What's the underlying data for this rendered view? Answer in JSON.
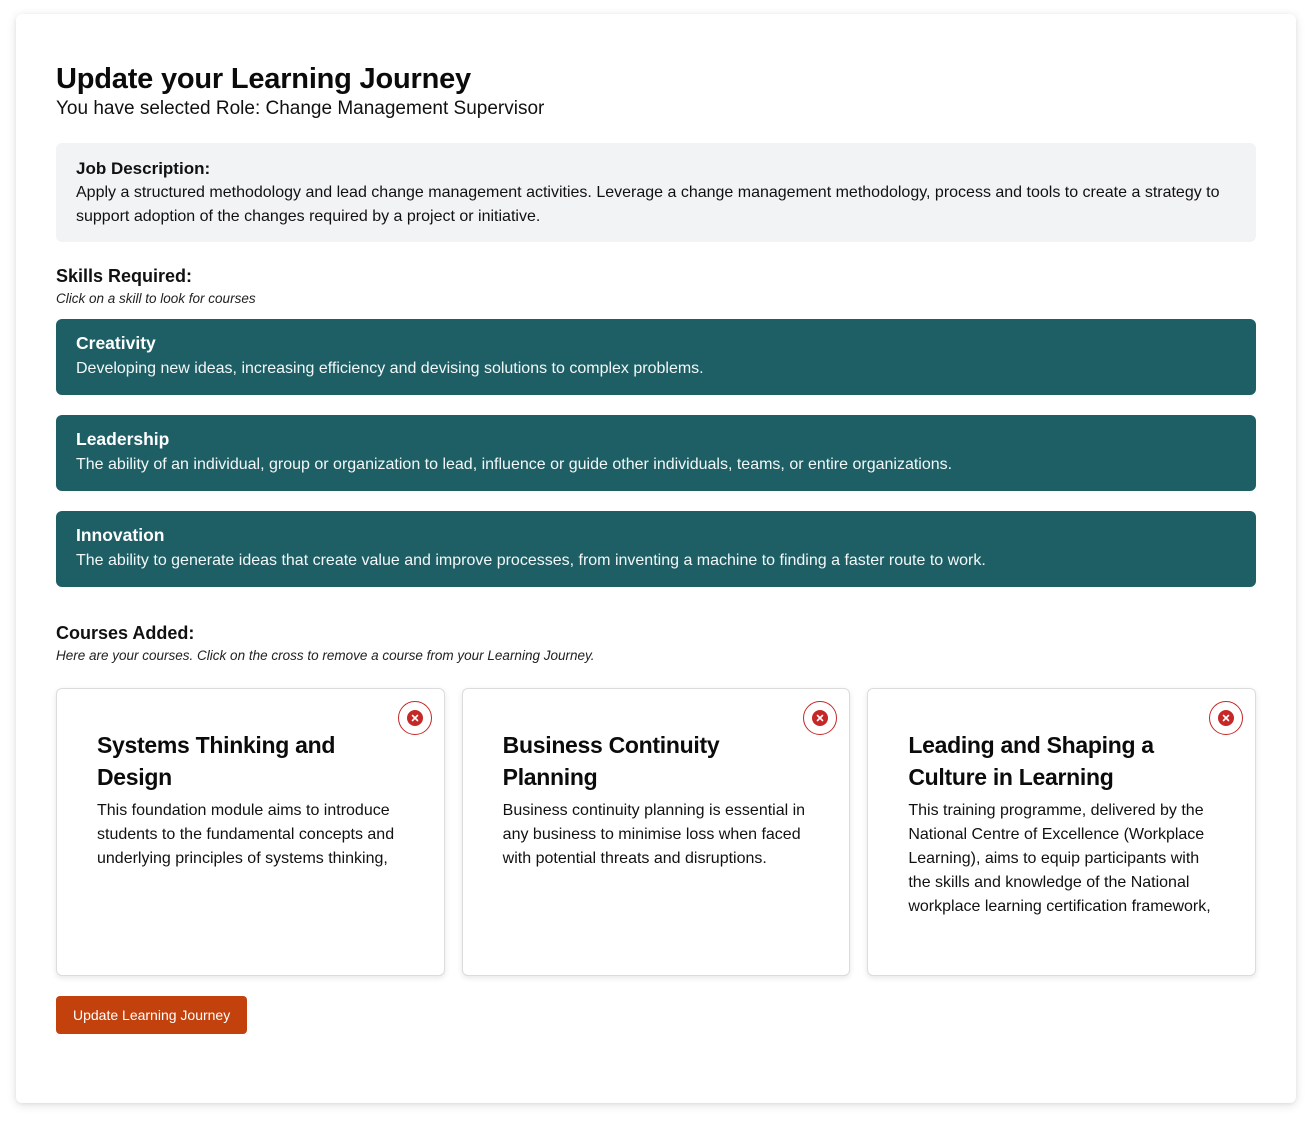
{
  "header": {
    "title": "Update your Learning Journey",
    "role_line": "You have selected Role: Change Management Supervisor"
  },
  "job": {
    "heading": "Job Description:",
    "text": "Apply a structured methodology and lead change management activities. Leverage a change management methodology, process and tools to create a strategy to support adoption of the changes required by a project or initiative."
  },
  "skills": {
    "heading": "Skills Required:",
    "hint": "Click on a skill to look for courses",
    "items": [
      {
        "name": "Creativity",
        "desc": "Developing new ideas, increasing efficiency and devising solutions to complex problems."
      },
      {
        "name": "Leadership",
        "desc": "The ability of an individual, group or organization to lead, influence or guide other individuals, teams, or entire organizations."
      },
      {
        "name": "Innovation",
        "desc": "The ability to generate ideas that create value and improve processes, from inventing a machine to finding a faster route to work."
      }
    ]
  },
  "courses": {
    "heading": "Courses Added:",
    "hint": "Here are your courses. Click on the cross to remove a course from your Learning Journey.",
    "items": [
      {
        "title": "Systems Thinking and Design",
        "desc": "This foundation module aims to introduce students to the fundamental concepts and underlying principles of systems thinking,"
      },
      {
        "title": "Business Continuity Planning",
        "desc": "Business continuity planning is essential in any business to minimise loss when faced with potential threats and disruptions."
      },
      {
        "title": "Leading and Shaping a Culture in Learning",
        "desc": "This training programme, delivered by the National Centre of Excellence (Workplace Learning), aims to equip participants with the skills and knowledge of the National workplace learning certification framework,"
      }
    ],
    "remove_icon": "close-circle-icon"
  },
  "actions": {
    "update_label": "Update Learning Journey"
  },
  "colors": {
    "skill_bg": "#1e5f66",
    "button_bg": "#c2410c",
    "remove_red": "#c62828",
    "job_bg": "#f2f3f5"
  }
}
